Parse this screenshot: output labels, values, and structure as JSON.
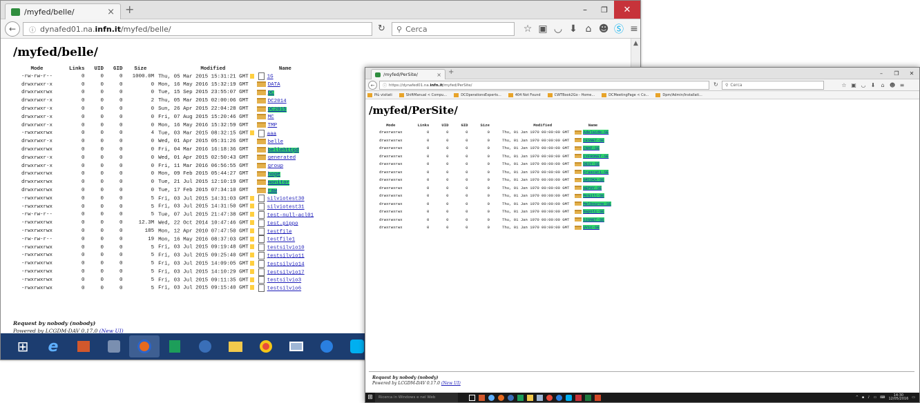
{
  "win1": {
    "tab_title": "/myfed/belle/",
    "url_prefix": "dynafed01.na.",
    "url_bold": "infn.it",
    "url_suffix": "/myfed/belle/",
    "search_placeholder": "Cerca",
    "page_title": "/myfed/belle/",
    "headers": [
      "Mode",
      "Links",
      "UID",
      "GID",
      "Size",
      "Modified",
      "Name"
    ],
    "rows": [
      {
        "mode": "-rw-rw-r--",
        "links": "0",
        "uid": "0",
        "gid": "0",
        "size": "1000.0M",
        "modified": "Thu, 05 Mar 2015 15:31:21 GMT",
        "type": "file",
        "gmt_icon": true,
        "name": "1G",
        "hl": false
      },
      {
        "mode": "drwxrwxr-x",
        "links": "0",
        "uid": "0",
        "gid": "0",
        "size": "0",
        "modified": "Mon, 16 May 2016 15:32:19 GMT",
        "type": "folder",
        "gmt_icon": false,
        "name": "DATA",
        "hl": false
      },
      {
        "mode": "drwxrwxrwx",
        "links": "0",
        "uid": "0",
        "gid": "0",
        "size": "0",
        "modified": "Tue, 15 Sep 2015 23:55:07 GMT",
        "type": "folder",
        "gmt_icon": false,
        "name": "DC",
        "hl": true
      },
      {
        "mode": "drwxrwxr-x",
        "links": "0",
        "uid": "0",
        "gid": "0",
        "size": "2",
        "modified": "Thu, 05 Mar 2015 02:00:06 GMT",
        "type": "folder",
        "gmt_icon": false,
        "name": "DC2014",
        "hl": false
      },
      {
        "mode": "drwxrwxr-x",
        "links": "0",
        "uid": "0",
        "gid": "0",
        "size": "0",
        "modified": "Sun, 26 Apr 2015 22:04:28 GMT",
        "type": "folder",
        "gmt_icon": false,
        "name": "DC2015",
        "hl": true
      },
      {
        "mode": "drwxrwxr-x",
        "links": "0",
        "uid": "0",
        "gid": "0",
        "size": "0",
        "modified": "Fri, 07 Aug 2015 15:20:46 GMT",
        "type": "folder",
        "gmt_icon": false,
        "name": "MC",
        "hl": false
      },
      {
        "mode": "drwxrwxr-x",
        "links": "0",
        "uid": "0",
        "gid": "0",
        "size": "0",
        "modified": "Mon, 16 May 2016 15:32:59 GMT",
        "type": "folder",
        "gmt_icon": false,
        "name": "TMP",
        "hl": false
      },
      {
        "mode": "-rwxrwxrwx",
        "links": "0",
        "uid": "0",
        "gid": "0",
        "size": "4",
        "modified": "Tue, 03 Mar 2015 08:32:15 GMT",
        "type": "file",
        "gmt_icon": true,
        "name": "aaa",
        "hl": false
      },
      {
        "mode": "drwxrwxr-x",
        "links": "0",
        "uid": "0",
        "gid": "0",
        "size": "0",
        "modified": "Wed, 01 Apr 2015 05:31:26 GMT",
        "type": "folder",
        "gmt_icon": false,
        "name": "belle",
        "hl": false
      },
      {
        "mode": "drwxrwxrwx",
        "links": "0",
        "uid": "0",
        "gid": "0",
        "size": "0",
        "modified": "Fri, 04 Mar 2016 16:18:36 GMT",
        "type": "folder",
        "gmt_icon": false,
        "name": "bellehttpd",
        "hl": true
      },
      {
        "mode": "drwxrwxr-x",
        "links": "0",
        "uid": "0",
        "gid": "0",
        "size": "0",
        "modified": "Wed, 01 Apr 2015 02:50:43 GMT",
        "type": "folder",
        "gmt_icon": false,
        "name": "generated",
        "hl": false
      },
      {
        "mode": "drwxrwxr-x",
        "links": "0",
        "uid": "0",
        "gid": "0",
        "size": "0",
        "modified": "Fri, 11 Mar 2016 06:56:55 GMT",
        "type": "folder",
        "gmt_icon": false,
        "name": "group",
        "hl": false
      },
      {
        "mode": "drwxrwxrwx",
        "links": "0",
        "uid": "0",
        "gid": "0",
        "size": "0",
        "modified": "Mon, 09 Feb 2015 05:44:27 GMT",
        "type": "folder",
        "gmt_icon": false,
        "name": "hoge",
        "hl": true
      },
      {
        "mode": "drwxrwxrwx",
        "links": "0",
        "uid": "0",
        "gid": "0",
        "size": "0",
        "modified": "Tue, 21 Jul 2015 12:10:19 GMT",
        "type": "folder",
        "gmt_icon": false,
        "name": "monitor",
        "hl": true
      },
      {
        "mode": "drwxrwxrwx",
        "links": "0",
        "uid": "0",
        "gid": "0",
        "size": "0",
        "modified": "Tue, 17 Feb 2015 07:34:10 GMT",
        "type": "folder",
        "gmt_icon": false,
        "name": "raw",
        "hl": true
      },
      {
        "mode": "-rwxrwxrwx",
        "links": "0",
        "uid": "0",
        "gid": "0",
        "size": "5",
        "modified": "Fri, 03 Jul 2015 14:31:03 GMT",
        "type": "file",
        "gmt_icon": true,
        "name": "silviotest30",
        "hl": false
      },
      {
        "mode": "-rwxrwxrwx",
        "links": "0",
        "uid": "0",
        "gid": "0",
        "size": "5",
        "modified": "Fri, 03 Jul 2015 14:31:50 GMT",
        "type": "file",
        "gmt_icon": true,
        "name": "silviotest31",
        "hl": false
      },
      {
        "mode": "-rw-rw-r--",
        "links": "0",
        "uid": "0",
        "gid": "0",
        "size": "5",
        "modified": "Tue, 07 Jul 2015 21:47:38 GMT",
        "type": "file",
        "gmt_icon": true,
        "name": "test-null-acl01",
        "hl": false
      },
      {
        "mode": "-rwxrwxrwx",
        "links": "0",
        "uid": "0",
        "gid": "0",
        "size": "12.3M",
        "modified": "Wed, 22 Oct 2014 10:47:46 GMT",
        "type": "file",
        "gmt_icon": true,
        "name": "test.pippo",
        "hl": false
      },
      {
        "mode": "-rwxrwxrwx",
        "links": "0",
        "uid": "0",
        "gid": "0",
        "size": "185",
        "modified": "Mon, 12 Apr 2010 07:47:50 GMT",
        "type": "file",
        "gmt_icon": true,
        "name": "testfile",
        "hl": false
      },
      {
        "mode": "-rw-rw-r--",
        "links": "0",
        "uid": "0",
        "gid": "0",
        "size": "19",
        "modified": "Mon, 16 May 2016 08:37:03 GMT",
        "type": "file",
        "gmt_icon": true,
        "name": "testfile1",
        "hl": false
      },
      {
        "mode": "-rwxrwxrwx",
        "links": "0",
        "uid": "0",
        "gid": "0",
        "size": "5",
        "modified": "Fri, 03 Jul 2015 09:19:48 GMT",
        "type": "file",
        "gmt_icon": true,
        "name": "testsilvio10",
        "hl": false
      },
      {
        "mode": "-rwxrwxrwx",
        "links": "0",
        "uid": "0",
        "gid": "0",
        "size": "5",
        "modified": "Fri, 03 Jul 2015 09:25:40 GMT",
        "type": "file",
        "gmt_icon": true,
        "name": "testsilvio11",
        "hl": false
      },
      {
        "mode": "-rwxrwxrwx",
        "links": "0",
        "uid": "0",
        "gid": "0",
        "size": "5",
        "modified": "Fri, 03 Jul 2015 14:09:05 GMT",
        "type": "file",
        "gmt_icon": true,
        "name": "testsilvio14",
        "hl": false
      },
      {
        "mode": "-rwxrwxrwx",
        "links": "0",
        "uid": "0",
        "gid": "0",
        "size": "5",
        "modified": "Fri, 03 Jul 2015 14:10:29 GMT",
        "type": "file",
        "gmt_icon": true,
        "name": "testsilvio17",
        "hl": false
      },
      {
        "mode": "-rwxrwxrwx",
        "links": "0",
        "uid": "0",
        "gid": "0",
        "size": "5",
        "modified": "Fri, 03 Jul 2015 09:11:35 GMT",
        "type": "file",
        "gmt_icon": true,
        "name": "testsilvio3",
        "hl": false
      },
      {
        "mode": "-rwxrwxrwx",
        "links": "0",
        "uid": "0",
        "gid": "0",
        "size": "5",
        "modified": "Fri, 03 Jul 2015 09:15:40 GMT",
        "type": "file",
        "gmt_icon": true,
        "name": "testsilvio6",
        "hl": false
      }
    ],
    "footer_request": "Request by nobody (nobody)",
    "footer_powered": "Powered by LCGDM-DAV 0.17.0",
    "footer_link": "(New UI)"
  },
  "win2": {
    "tab_title": "/myfed/PerSite/",
    "url_prefix": "https://dynafed01.na.",
    "url_bold": "infn.it",
    "url_suffix": "/myfed/PerSite/",
    "search_placeholder": "Cerca",
    "bookmarks": [
      "Più visitati",
      "ShiftManual < Compu...",
      "DCOperationsExperts...",
      "404 Not Found",
      "CWTBook2Go - Home...",
      "DCMeetingPage < Co...",
      "Dpm/Admin/Installati..."
    ],
    "page_title": "/myfed/PerSite/",
    "headers": [
      "Mode",
      "Links",
      "UID",
      "GID",
      "Size",
      "Modified",
      "Name"
    ],
    "rows": [
      {
        "mode": "drwxrwxrwx",
        "links": "0",
        "uid": "0",
        "gid": "0",
        "size": "0",
        "modified": "Thu, 01 Jan 1970 00:00:00 GMT",
        "name": "Adelaide-SE"
      },
      {
        "mode": "drwxrwxrwx",
        "links": "0",
        "uid": "0",
        "gid": "0",
        "size": "0",
        "modified": "Thu, 01 Jan 1970 00:00:00 GMT",
        "name": "CESNET-SE"
      },
      {
        "mode": "drwxrwxrwx",
        "links": "0",
        "uid": "0",
        "gid": "0",
        "size": "0",
        "modified": "Thu, 01 Jan 1970 00:00:00 GMT",
        "name": "CNAF-SE"
      },
      {
        "mode": "drwxrwxrwx",
        "links": "0",
        "uid": "0",
        "gid": "0",
        "size": "0",
        "modified": "Thu, 01 Jan 1970 00:00:00 GMT",
        "name": "CYFRONET-SE"
      },
      {
        "mode": "drwxrwxrwx",
        "links": "0",
        "uid": "0",
        "gid": "0",
        "size": "0",
        "modified": "Thu, 01 Jan 1970 00:00:00 GMT",
        "name": "DESY-SE"
      },
      {
        "mode": "drwxrwxrwx",
        "links": "0",
        "uid": "0",
        "gid": "0",
        "size": "0",
        "modified": "Thu, 01 Jan 1970 00:00:00 GMT",
        "name": "Frascati-SE"
      },
      {
        "mode": "drwxrwxrwx",
        "links": "0",
        "uid": "0",
        "gid": "0",
        "size": "0",
        "modified": "Thu, 01 Jan 1970 00:00:00 GMT",
        "name": "GRIDKA-SE"
      },
      {
        "mode": "drwxrwxrwx",
        "links": "0",
        "uid": "0",
        "gid": "0",
        "size": "0",
        "modified": "Thu, 01 Jan 1970 00:00:00 GMT",
        "name": "HEPHY-SE"
      },
      {
        "mode": "drwxrwxrwx",
        "links": "0",
        "uid": "0",
        "gid": "0",
        "size": "0",
        "modified": "Thu, 01 Jan 1970 00:00:00 GMT",
        "name": "McGill-SE"
      },
      {
        "mode": "drwxrwxrwx",
        "links": "0",
        "uid": "0",
        "gid": "0",
        "size": "0",
        "modified": "Thu, 01 Jan 1970 00:00:00 GMT",
        "name": "Melbourne-SE"
      },
      {
        "mode": "drwxrwxrwx",
        "links": "0",
        "uid": "0",
        "gid": "0",
        "size": "0",
        "modified": "Thu, 01 Jan 1970 00:00:00 GMT",
        "name": "Napoli-SE"
      },
      {
        "mode": "drwxrwxrwx",
        "links": "0",
        "uid": "0",
        "gid": "0",
        "size": "0",
        "modified": "Thu, 01 Jan 1970 00:00:00 GMT",
        "name": "SIGNET-SE"
      },
      {
        "mode": "drwxrwxrwx",
        "links": "0",
        "uid": "0",
        "gid": "0",
        "size": "0",
        "modified": "Thu, 01 Jan 1970 00:00:00 GMT",
        "name": "UVic-SE"
      }
    ],
    "footer_request": "Request by nobody (nobody)",
    "footer_powered": "Powered by LCGDM-DAV 0.17.0",
    "footer_link": "(New UI)",
    "taskbar_search": "Ricerca in Windows e nel Web",
    "clock_time": "14:30",
    "clock_date": "12/05/2016"
  },
  "colors": {
    "highlight": "#2fd46a",
    "link": "#1a1ab8",
    "taskbar_classic": "#1c3d70",
    "taskbar_dark": "#1a1a1a",
    "close_button": "#c7333a"
  }
}
